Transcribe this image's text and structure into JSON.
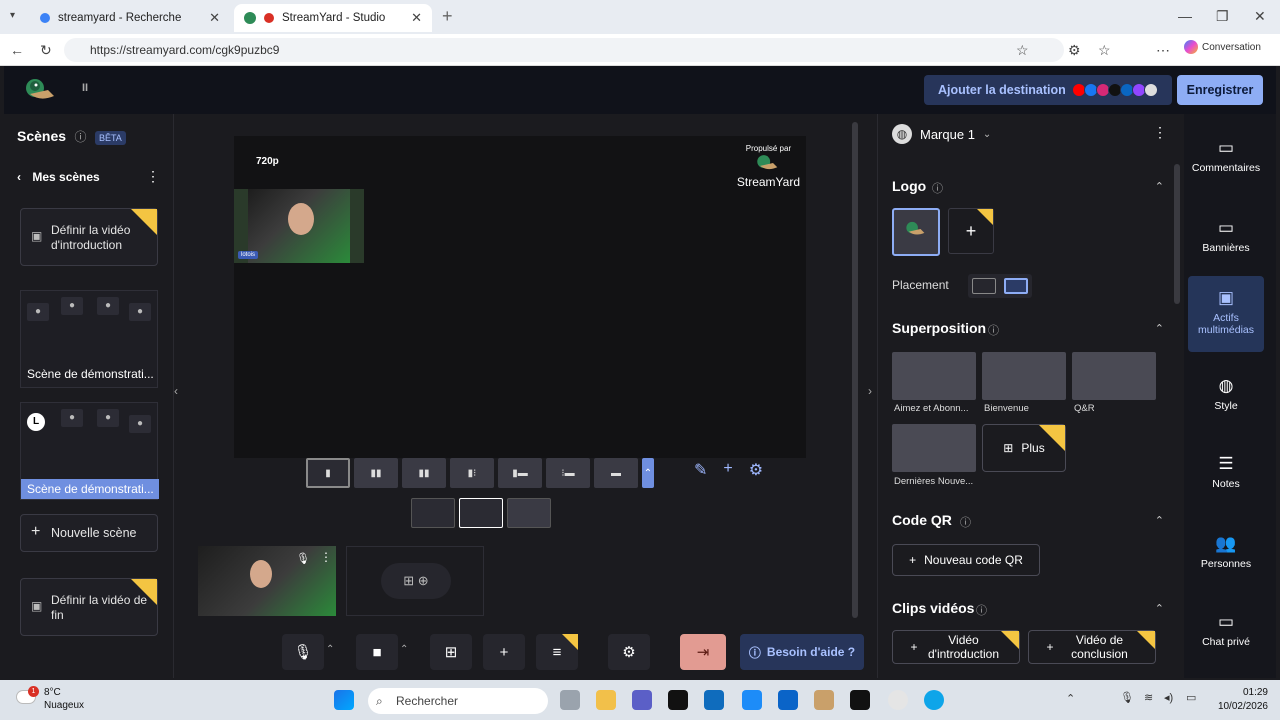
{
  "browser": {
    "tabs": [
      {
        "title": "streamyard - Recherche",
        "close": "✕"
      },
      {
        "title": "StreamYard - Studio",
        "close": "✕"
      }
    ],
    "new_tab": "+",
    "url": "https://streamyard.com/cgk9puzbc9",
    "conversation": "Conversation",
    "win_controls": [
      "—",
      "❐",
      "✕"
    ]
  },
  "topbar": {
    "pause": "II",
    "add_destination": "Ajouter la destination",
    "record": "Enregistrer"
  },
  "left_panel": {
    "title": "Scènes",
    "beta": "BÊTA",
    "my_scenes": "Mes scènes",
    "intro_video": "Définir la vidéo d'introduction",
    "scene1_label": "Scène de démonstrati...",
    "scene2_label": "Scène de démonstrati...",
    "new_scene": "Nouvelle scène",
    "outro_video": "Définir la vidéo de fin"
  },
  "stage": {
    "resolution": "720p",
    "powered_by": "Propulsé par",
    "brand": "StreamYard",
    "name_tag": "lotois"
  },
  "bottom_bar": {
    "help": "Besoin d'aide ?"
  },
  "right_panel": {
    "brand_name": "Marque 1",
    "logo_title": "Logo",
    "placement": "Placement",
    "overlay_title": "Superposition",
    "overlays": [
      "Aimez et Abonn...",
      "Bienvenue",
      "Q&R",
      "Dernières Nouve..."
    ],
    "more": "Plus",
    "qr_title": "Code QR",
    "new_qr": "Nouveau code QR",
    "clips_title": "Clips vidéos",
    "clip_intro": "Vidéo d'introduction",
    "clip_outro": "Vidéo de conclusion"
  },
  "sidebar": {
    "items": [
      "Commentaires",
      "Bannières",
      "Actifs multimédias",
      "Style",
      "Notes",
      "Personnes",
      "Chat privé"
    ]
  },
  "taskbar": {
    "temperature": "8°C",
    "weather": "Nuageux",
    "search": "Rechercher",
    "time": "01:29",
    "date": "10/02/2026",
    "badge": "1"
  },
  "colors": {
    "accent": "#8eadf5",
    "dest_bg": "#27355a",
    "star": "#f4c542"
  }
}
